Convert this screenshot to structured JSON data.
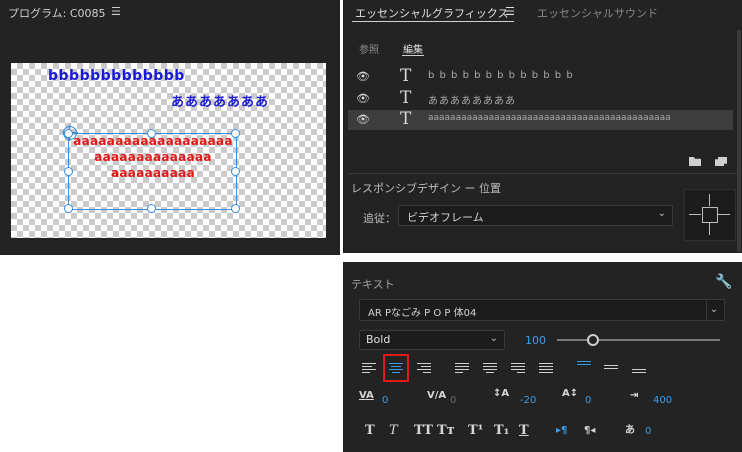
{
  "program": {
    "title": "プログラム: C0085",
    "menu_icon": "hamburger-icon",
    "canvas": {
      "line1": "bbbbbbbbbbbbb",
      "line2": "あああああああ",
      "red_lines": [
        "aaaaaaaaaaaaaaaaaaa",
        "aaaaaaaaaaaaaa",
        "aaaaaaaaaa"
      ]
    }
  },
  "essential_graphics": {
    "tabs": [
      {
        "label": "エッセンシャルグラフィックス",
        "active": true
      },
      {
        "label": "エッセンシャルサウンド",
        "active": false
      }
    ],
    "menu_icon": "hamburger-icon",
    "subtabs": [
      {
        "label": "参照",
        "active": false
      },
      {
        "label": "編集",
        "active": true
      }
    ],
    "layers": [
      {
        "text": "b b b b b b b b b b b b b",
        "selected": false
      },
      {
        "text": "ああああああああ",
        "selected": false
      },
      {
        "text": "aaaaaaaaaaaaaaaaaaaaaaaaaaaaaaaaaaaaaaaaaaaa",
        "selected": true
      }
    ],
    "responsive_title": "レスポンシブデザイン ー 位置",
    "follow_label": "追従：",
    "follow_value": "ビデオフレーム"
  },
  "text_panel": {
    "title": "テキスト",
    "font_name": "AR Pなごみ P O P 体04",
    "font_style": "Bold",
    "font_size": "100",
    "font_size_slider_fraction": 0.22,
    "align_buttons": [
      {
        "name": "align-left-icon",
        "active": false
      },
      {
        "name": "align-center-icon",
        "active": true
      },
      {
        "name": "align-right-icon",
        "active": false
      },
      {
        "name": "justify-last-left-icon",
        "active": false
      },
      {
        "name": "justify-last-center-icon",
        "active": false
      },
      {
        "name": "justify-last-right-icon",
        "active": false
      },
      {
        "name": "justify-all-icon",
        "active": false
      },
      {
        "name": "align-top-icon",
        "active": true
      },
      {
        "name": "align-middle-icon",
        "active": false
      },
      {
        "name": "align-bottom-icon",
        "active": false
      }
    ],
    "metrics": {
      "kerning": "0",
      "tracking": "0",
      "leading": "-20",
      "baseline_shift": "0",
      "tab_width": "400",
      "tsume": "0"
    },
    "type_styles": [
      "T",
      "T",
      "TT",
      "Tт",
      "T¹",
      "T₁",
      "T"
    ],
    "accent_color": "#3a9dea"
  }
}
